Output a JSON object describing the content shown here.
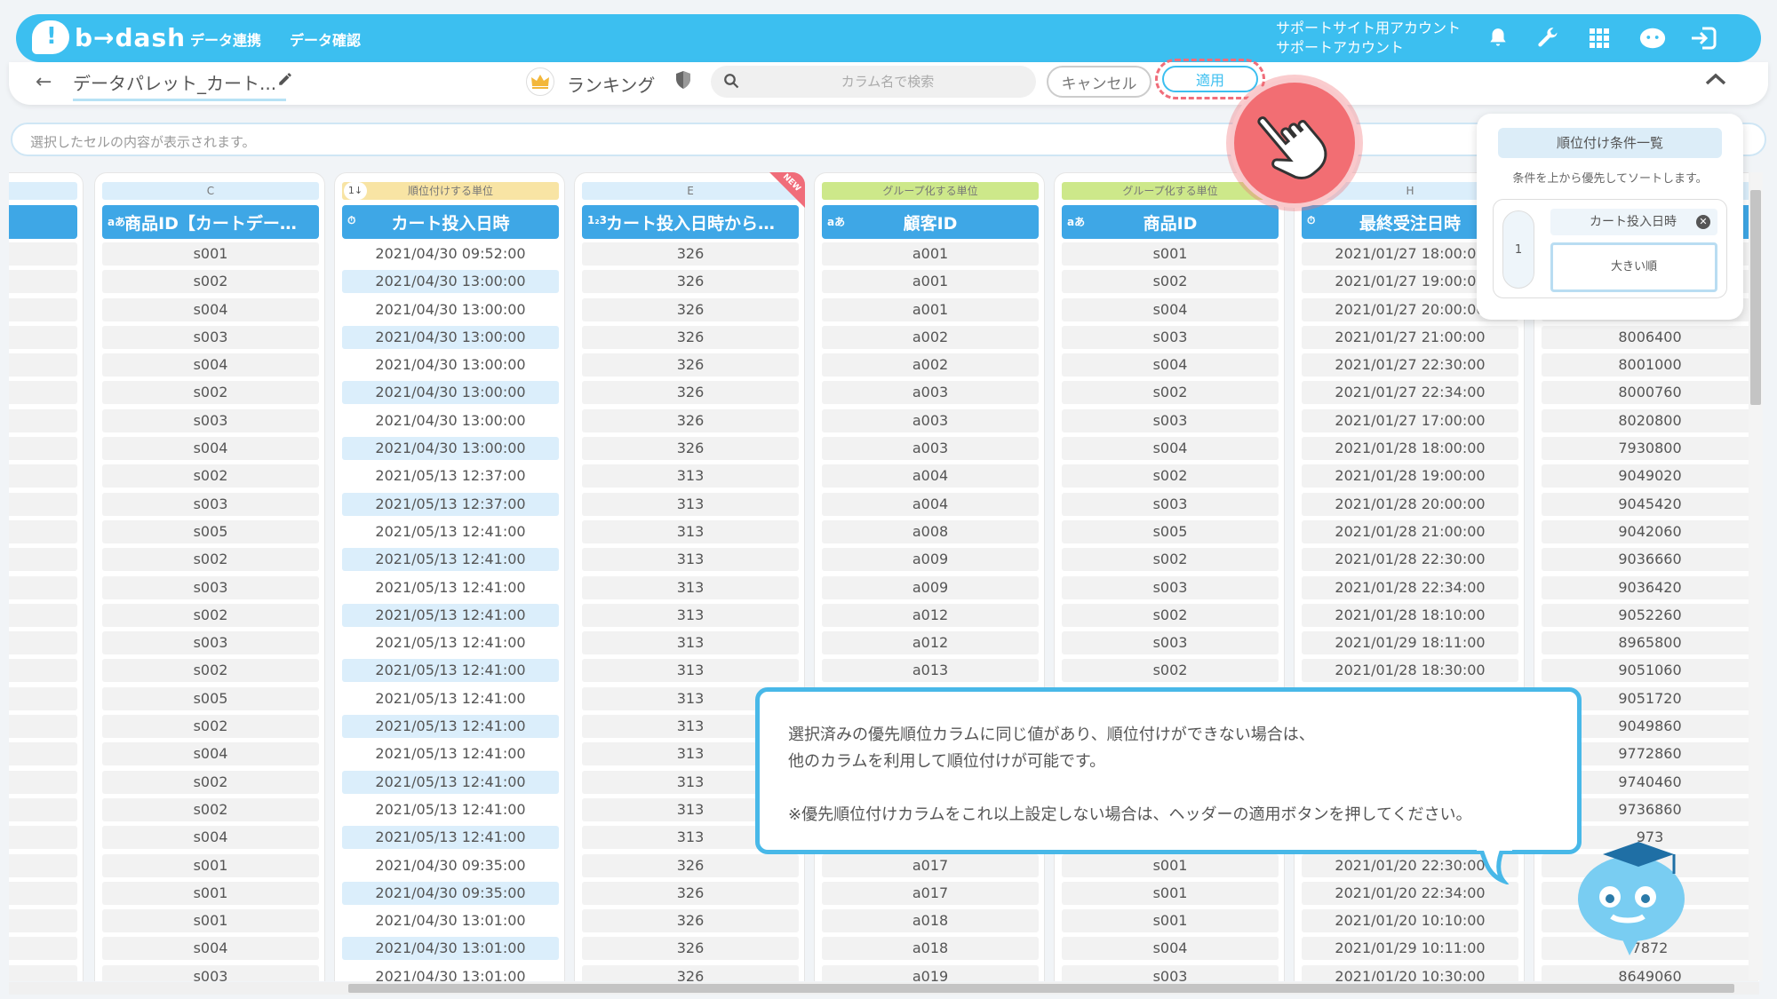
{
  "app": {
    "logo_text": "b→dash",
    "nav": [
      "データ連携",
      "データ確認"
    ],
    "account_line1": "サポートサイト用アカウント",
    "account_line2": "サポートアカウント"
  },
  "header": {
    "palette_name": "データパレット_カート...",
    "mode_label": "ランキング",
    "search_placeholder": "カラム名で検索",
    "cancel_label": "キャンセル",
    "apply_label": "適用"
  },
  "cell_bar": {
    "placeholder": "選択したセルの内容が表示されます。"
  },
  "columns": [
    {
      "label": "ー…",
      "type": "",
      "tag": "",
      "tag_color": "#dbeefb",
      "cells": [
        "",
        "",
        "",
        "",
        "",
        "",
        "",
        "",
        "",
        "",
        "",
        "",
        "",
        "",
        "",
        "",
        "",
        "",
        "",
        "",
        "",
        "",
        "",
        "",
        "",
        "",
        ""
      ]
    },
    {
      "label": "商品ID【カートデー…",
      "type": "aあ",
      "tag": "C",
      "tag_color": "#dbeefb",
      "cells": [
        "s001",
        "s002",
        "s004",
        "s003",
        "s004",
        "s002",
        "s003",
        "s004",
        "s002",
        "s003",
        "s005",
        "s002",
        "s003",
        "s002",
        "s003",
        "s002",
        "s005",
        "s002",
        "s004",
        "s002",
        "s002",
        "s004",
        "s001",
        "s001",
        "s001",
        "s004",
        "s003"
      ]
    },
    {
      "label": "カート投入日時",
      "type": "⏱",
      "tag": "順位付けする単位",
      "tag_color": "#f8e4a4",
      "sort_badge": "1↓",
      "cells": [
        "2021/04/30 09:52:00",
        "2021/04/30 13:00:00",
        "2021/04/30 13:00:00",
        "2021/04/30 13:00:00",
        "2021/04/30 13:00:00",
        "2021/04/30 13:00:00",
        "2021/04/30 13:00:00",
        "2021/04/30 13:00:00",
        "2021/05/13 12:37:00",
        "2021/05/13 12:37:00",
        "2021/05/13 12:41:00",
        "2021/05/13 12:41:00",
        "2021/05/13 12:41:00",
        "2021/05/13 12:41:00",
        "2021/05/13 12:41:00",
        "2021/05/13 12:41:00",
        "2021/05/13 12:41:00",
        "2021/05/13 12:41:00",
        "2021/05/13 12:41:00",
        "2021/05/13 12:41:00",
        "2021/05/13 12:41:00",
        "2021/05/13 12:41:00",
        "2021/04/30 09:35:00",
        "2021/04/30 09:35:00",
        "2021/04/30 13:01:00",
        "2021/04/30 13:01:00",
        "2021/04/30 13:01:00"
      ]
    },
    {
      "label": "カート投入日時から…",
      "type": "1₂3",
      "tag": "E",
      "tag_color": "#dbeefb",
      "new_badge": "NEW",
      "cells": [
        "326",
        "326",
        "326",
        "326",
        "326",
        "326",
        "326",
        "326",
        "313",
        "313",
        "313",
        "313",
        "313",
        "313",
        "313",
        "313",
        "313",
        "313",
        "313",
        "313",
        "313",
        "313",
        "326",
        "326",
        "326",
        "326",
        "326"
      ]
    },
    {
      "label": "顧客ID",
      "type": "aあ",
      "tag": "グループ化する単位",
      "tag_color": "#cde88a",
      "cells": [
        "a001",
        "a001",
        "a001",
        "a002",
        "a002",
        "a003",
        "a003",
        "a003",
        "a004",
        "a004",
        "a008",
        "a009",
        "a009",
        "a012",
        "a012",
        "a013",
        "",
        "",
        "",
        "",
        "",
        "",
        "a017",
        "a017",
        "a018",
        "a018",
        "a019"
      ]
    },
    {
      "label": "商品ID",
      "type": "aあ",
      "tag": "グループ化する単位",
      "tag_color": "#cde88a",
      "cells": [
        "s001",
        "s002",
        "s004",
        "s003",
        "s004",
        "s002",
        "s003",
        "s004",
        "s002",
        "s003",
        "s005",
        "s002",
        "s003",
        "s002",
        "s003",
        "s002",
        "",
        "",
        "",
        "",
        "",
        "",
        "s001",
        "s001",
        "s001",
        "s004",
        "s003"
      ]
    },
    {
      "label": "最終受注日時",
      "type": "⏱",
      "tag": "H",
      "tag_color": "#dbeefb",
      "cells": [
        "2021/01/27 18:00:00",
        "2021/01/27 19:00:00",
        "2021/01/27 20:00:00",
        "2021/01/27 21:00:00",
        "2021/01/27 22:30:00",
        "2021/01/27 22:34:00",
        "2021/01/27 17:00:00",
        "2021/01/28 18:00:00",
        "2021/01/28 19:00:00",
        "2021/01/28 20:00:00",
        "2021/01/28 21:00:00",
        "2021/01/28 22:30:00",
        "2021/01/28 22:34:00",
        "2021/01/28 18:10:00",
        "2021/01/29 18:11:00",
        "2021/01/28 18:30:00",
        "",
        "",
        "",
        "",
        "",
        "",
        "2021/01/20 22:30:00",
        "2021/01/20 22:34:00",
        "2021/01/20 10:10:00",
        "2021/01/29 10:11:00",
        "2021/01/20 10:30:00"
      ]
    },
    {
      "label": "",
      "type": "",
      "tag": "",
      "tag_color": "#dbeefb",
      "cells": [
        "",
        "",
        "",
        "8006400",
        "8001000",
        "8000760",
        "8020800",
        "7930800",
        "9049020",
        "9045420",
        "9042060",
        "9036660",
        "9036420",
        "9052260",
        "8965800",
        "9051060",
        "9051720",
        "9049860",
        "9772860",
        "9740460",
        "9736860",
        "973",
        "",
        "",
        "",
        "7872",
        "8649060"
      ]
    }
  ],
  "ranking_panel": {
    "title": "順位付け条件一覧",
    "description": "条件を上から優先してソートします。",
    "items": [
      {
        "rank": "1",
        "column": "カート投入日時",
        "order": "大きい順"
      }
    ]
  },
  "tooltip": {
    "line1": "選択済みの優先順位カラムに同じ値があり、順位付けができない場合は、",
    "line2": "他のカラムを利用して順位付けが可能です。",
    "line3": "※優先順位付けカラムをこれ以上設定しない場合は、ヘッダーの適用ボタンを押してください。"
  },
  "colors": {
    "accent": "#3cbff0",
    "header_blue": "#3ea7e6",
    "highlight": "#f06d7a"
  },
  "icons": [
    "bell-icon",
    "wrench-icon",
    "grid-icon",
    "support-mascot-icon",
    "logout-icon",
    "back-arrow-icon",
    "pencil-icon",
    "crown-icon",
    "shield-icon",
    "search-icon",
    "chevron-up-icon",
    "hand-pointer-icon",
    "clock-icon"
  ]
}
